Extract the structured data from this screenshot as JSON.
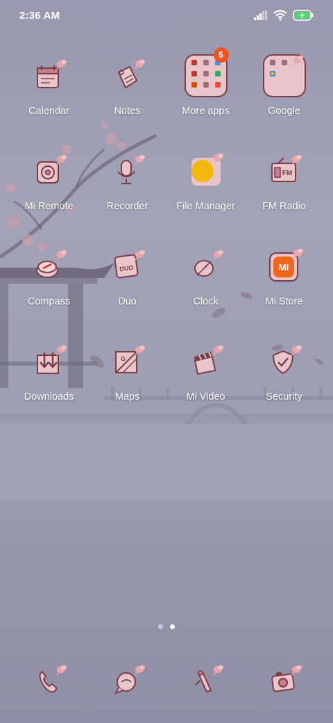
{
  "status_bar": {
    "time": "2:36 AM"
  },
  "apps": [
    [
      {
        "label": "Calendar",
        "icon": "calendar-icon"
      },
      {
        "label": "Notes",
        "icon": "notes-icon"
      },
      {
        "label": "More apps",
        "icon": "folder-icon",
        "badge": "5"
      },
      {
        "label": "Google",
        "icon": "folder-icon"
      }
    ],
    [
      {
        "label": "Mi Remote",
        "icon": "remote-icon"
      },
      {
        "label": "Recorder",
        "icon": "microphone-icon"
      },
      {
        "label": "File Manager",
        "icon": "folder-yellow-icon"
      },
      {
        "label": "FM Radio",
        "icon": "radio-icon"
      }
    ],
    [
      {
        "label": "Compass",
        "icon": "compass-icon"
      },
      {
        "label": "Duo",
        "icon": "duo-icon"
      },
      {
        "label": "Clock",
        "icon": "clock-icon"
      },
      {
        "label": "Mi Store",
        "icon": "mi-store-icon"
      }
    ],
    [
      {
        "label": "Downloads",
        "icon": "download-icon"
      },
      {
        "label": "Maps",
        "icon": "maps-icon"
      },
      {
        "label": "Mi Video",
        "icon": "video-icon"
      },
      {
        "label": "Security",
        "icon": "shield-icon"
      }
    ]
  ],
  "more_apps_folder": {
    "badge": "5"
  },
  "mi_store_logo": "MI",
  "duo_icon_text": "DUO",
  "fm_icon_text": "FM",
  "dock": [
    {
      "icon": "phone-icon"
    },
    {
      "icon": "messages-icon"
    },
    {
      "icon": "browser-icon"
    },
    {
      "icon": "camera-icon"
    }
  ],
  "colors": {
    "icon_stroke": "#7a3d4a",
    "icon_fill": "#e8c5c8",
    "badge": "#f0541e",
    "mi_orange": "#f0641e",
    "file_manager_yellow": "#f3b80f"
  }
}
